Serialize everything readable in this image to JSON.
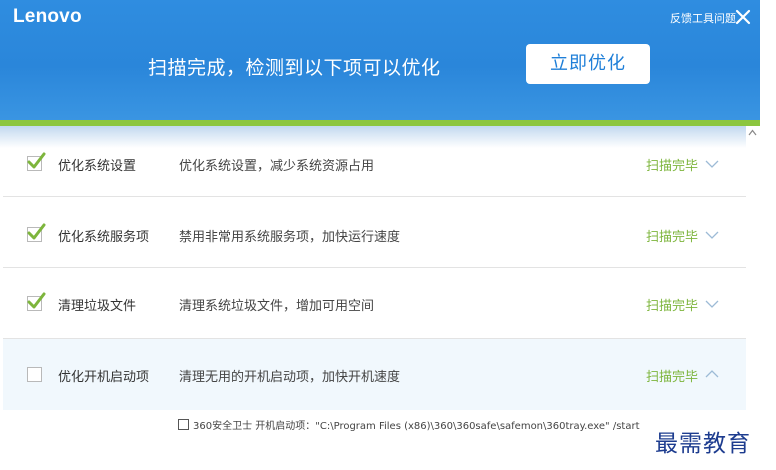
{
  "header": {
    "brand": "Lenovo",
    "feedback": "反馈工具问题",
    "headline": "扫描完成，检测到以下项可以优化",
    "optimize_button": "立即优化"
  },
  "items": [
    {
      "checked": true,
      "title": "优化系统设置",
      "desc": "优化系统设置，减少系统资源占用",
      "status": "扫描完毕",
      "expanded": false
    },
    {
      "checked": true,
      "title": "优化系统服务项",
      "desc": "禁用非常用系统服务项，加快运行速度",
      "status": "扫描完毕",
      "expanded": false
    },
    {
      "checked": true,
      "title": "清理垃圾文件",
      "desc": "清理系统垃圾文件，增加可用空间",
      "status": "扫描完毕",
      "expanded": false
    },
    {
      "checked": false,
      "title": "优化开机启动项",
      "desc": "清理无用的开机启动项，加快开机速度",
      "status": "扫描完毕",
      "expanded": true
    }
  ],
  "startup_entry": {
    "checked": false,
    "text": "360安全卫士 开机启动项：\"C:\\Program Files (x86)\\360\\360safe\\safemon\\360tray.exe\" /start"
  },
  "watermark": "最需教育",
  "colors": {
    "header_blue": "#2a86da",
    "accent_green": "#8cc63f",
    "status_green": "#7db53c"
  }
}
